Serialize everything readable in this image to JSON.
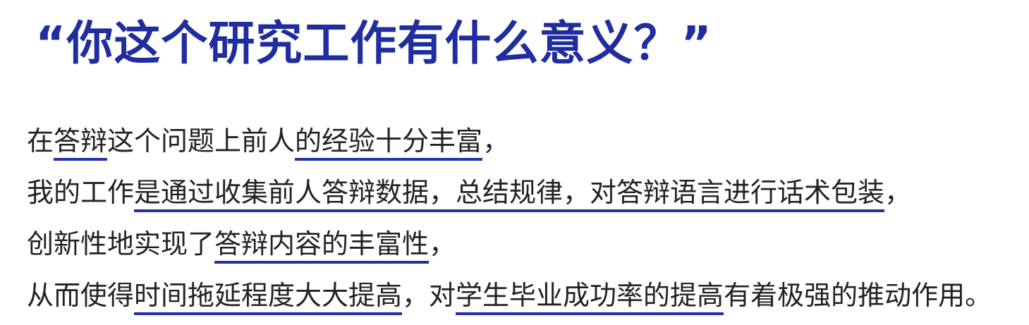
{
  "title": "“你这个研究工作有什么意义？”",
  "lines": [
    [
      {
        "text": "在",
        "u": false
      },
      {
        "text": "答辩",
        "u": true
      },
      {
        "text": "这个问题上前人",
        "u": false
      },
      {
        "text": "的经验十分丰富",
        "u": true
      },
      {
        "text": "，",
        "u": false
      }
    ],
    [
      {
        "text": "我的工作",
        "u": false
      },
      {
        "text": "是通过收集前人答辩数据，总结规律，对答辩语言进行话术包装",
        "u": true
      },
      {
        "text": "，",
        "u": false
      }
    ],
    [
      {
        "text": "创新性地实现了",
        "u": false
      },
      {
        "text": "答辩内容的丰富性",
        "u": true
      },
      {
        "text": "，",
        "u": false
      }
    ],
    [
      {
        "text": "从而使得",
        "u": false
      },
      {
        "text": "时间拖延程度大大提高",
        "u": true
      },
      {
        "text": "，对",
        "u": false
      },
      {
        "text": "学生毕业成功率的提高",
        "u": true
      },
      {
        "text": "有着极强的推动作用。",
        "u": false
      }
    ]
  ],
  "colors": {
    "title": "#1f2d9e",
    "body_text": "#222222",
    "underline": "#2330a8",
    "background": "#ffffff"
  }
}
